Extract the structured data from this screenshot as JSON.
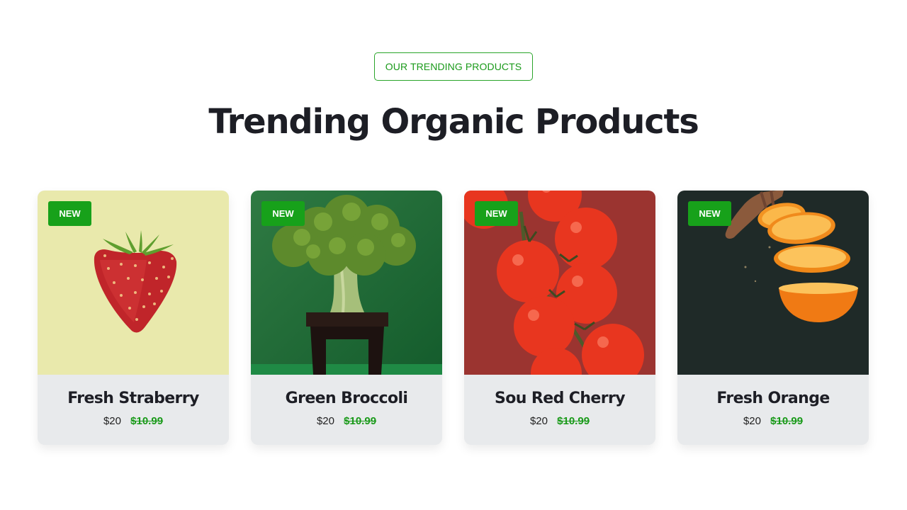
{
  "header": {
    "eyebrow": "OUR TRENDING PRODUCTS",
    "title": "Trending Organic Products"
  },
  "colors": {
    "accent": "#17a11a",
    "title": "#1d1e25",
    "card_info_bg": "#e8eaec"
  },
  "products": [
    {
      "badge": "NEW",
      "name": "Fresh Straberry",
      "price": "$20",
      "old_price": "$10.99",
      "image_icon": "strawberry-image"
    },
    {
      "badge": "NEW",
      "name": "Green Broccoli",
      "price": "$20",
      "old_price": "$10.99",
      "image_icon": "broccoli-image"
    },
    {
      "badge": "NEW",
      "name": "Sou Red Cherry",
      "price": "$20",
      "old_price": "$10.99",
      "image_icon": "cherry-tomato-image"
    },
    {
      "badge": "NEW",
      "name": "Fresh Orange",
      "price": "$20",
      "old_price": "$10.99",
      "image_icon": "orange-slices-image"
    }
  ]
}
